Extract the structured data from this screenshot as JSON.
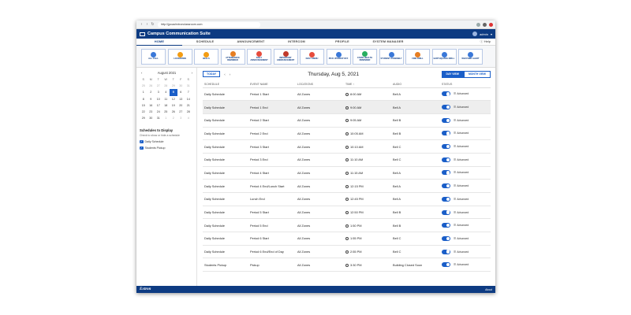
{
  "browser": {
    "url": "http://jpcca/extronclassroom.com"
  },
  "app": {
    "title": "Campus Communication Suite",
    "user": "admin",
    "help": "Help"
  },
  "tabs": [
    "HOME",
    "SCHEDULE",
    "ANNOUNCEMENT",
    "INTERCOM",
    "PROFILE",
    "SYSTEM MANAGER"
  ],
  "quick_buttons": [
    {
      "label": "ALL CALL",
      "icon": "megaphone-icon",
      "color": "#3a78d8"
    },
    {
      "label": "LOCKDOWN",
      "icon": "lock-icon",
      "color": "#f39c12"
    },
    {
      "label": "BELLS",
      "icon": "bell-icon",
      "color": "#f39c12"
    },
    {
      "label": "ATTENDANCE REMINDER",
      "icon": "attendance-icon",
      "color": "#e67e22"
    },
    {
      "label": "DAILY ANNOUNCEMENT",
      "icon": "announce-icon",
      "color": "#e74c3c"
    },
    {
      "label": "IMPORTANT ANNOUNCEMENT",
      "icon": "alert-icon",
      "color": "#c0392b"
    },
    {
      "label": "DAILY MENU",
      "icon": "menu-icon",
      "color": "#e74c3c"
    },
    {
      "label": "PICK UP/DROP OFF",
      "icon": "car-icon",
      "color": "#3a78d8"
    },
    {
      "label": "COVID HEALTH REMINDER",
      "icon": "health-icon",
      "color": "#27ae60"
    },
    {
      "label": "STUDENT ASSEMBLY",
      "icon": "assembly-icon",
      "color": "#3a78d8"
    },
    {
      "label": "FIRE DRILL",
      "icon": "fire-icon",
      "color": "#e67e22"
    },
    {
      "label": "EARTHQUAKE DRILL",
      "icon": "earthquake-icon",
      "color": "#3a78d8"
    },
    {
      "label": "WEATHER ALERT",
      "icon": "weather-icon",
      "color": "#3a78d8"
    }
  ],
  "calendar": {
    "month": "August 2021",
    "dow": [
      "S",
      "M",
      "T",
      "W",
      "T",
      "F",
      "S"
    ],
    "rows": [
      [
        "25",
        "26",
        "27",
        "28",
        "29",
        "30",
        "31"
      ],
      [
        "1",
        "2",
        "3",
        "4",
        "5",
        "6",
        "7"
      ],
      [
        "8",
        "9",
        "10",
        "11",
        "12",
        "13",
        "14"
      ],
      [
        "15",
        "16",
        "17",
        "18",
        "19",
        "20",
        "21"
      ],
      [
        "22",
        "23",
        "24",
        "25",
        "26",
        "27",
        "28"
      ],
      [
        "29",
        "30",
        "31",
        "1",
        "2",
        "3",
        "4"
      ]
    ],
    "selected": "5"
  },
  "schedules_panel": {
    "title": "Schedules to Display",
    "hint": "Check to show or hide a schedule",
    "items": [
      "Daily Schedule",
      "Students Pickup"
    ]
  },
  "toolbar": {
    "today": "TODAY",
    "date": "Thursday, Aug 5, 2021",
    "day_view": "DAY VIEW",
    "month_view": "MONTH VIEW"
  },
  "columns": [
    "SCHEDULE",
    "EVENT NAME",
    "LOCATIONS",
    "TIME",
    "AUDIO",
    "STATUS"
  ],
  "rows": [
    [
      "Daily Schedule",
      "Period 1 Start",
      "All Zones",
      "8:00 AM",
      "Bell A"
    ],
    [
      "Daily Schedule",
      "Period 1 End",
      "All Zones",
      "9:00 AM",
      "Bell A"
    ],
    [
      "Daily Schedule",
      "Period 2 Start",
      "All Zones",
      "9:05 AM",
      "Bell B"
    ],
    [
      "Daily Schedule",
      "Period 2 End",
      "All Zones",
      "10:05 AM",
      "Bell B"
    ],
    [
      "Daily Schedule",
      "Period 3 Start",
      "All Zones",
      "10:10 AM",
      "Bell C"
    ],
    [
      "Daily Schedule",
      "Period 3 End",
      "All Zones",
      "11:10 AM",
      "Bell C"
    ],
    [
      "Daily Schedule",
      "Period 4 Start",
      "All Zones",
      "11:15 AM",
      "Bell A"
    ],
    [
      "Daily Schedule",
      "Period 4 End/Lunch Start",
      "All Zones",
      "12:15 PM",
      "Bell A"
    ],
    [
      "Daily Schedule",
      "Lunch End",
      "All Zones",
      "12:45 PM",
      "Bell A"
    ],
    [
      "Daily Schedule",
      "Period 5 Start",
      "All Zones",
      "12:50 PM",
      "Bell B"
    ],
    [
      "Daily Schedule",
      "Period 5 End",
      "All Zones",
      "1:50 PM",
      "Bell B"
    ],
    [
      "Daily Schedule",
      "Period 6 Start",
      "All Zones",
      "1:55 PM",
      "Bell C"
    ],
    [
      "Daily Schedule",
      "Period 6 End/End of Day",
      "All Zones",
      "2:55 PM",
      "Bell C"
    ],
    [
      "Students Pickup",
      "Pickup",
      "All Zones",
      "3:30 PM",
      "Building Closed Soon"
    ]
  ],
  "advanced_label": "Advanced",
  "footer": {
    "logo": "Extron",
    "about": "About"
  }
}
